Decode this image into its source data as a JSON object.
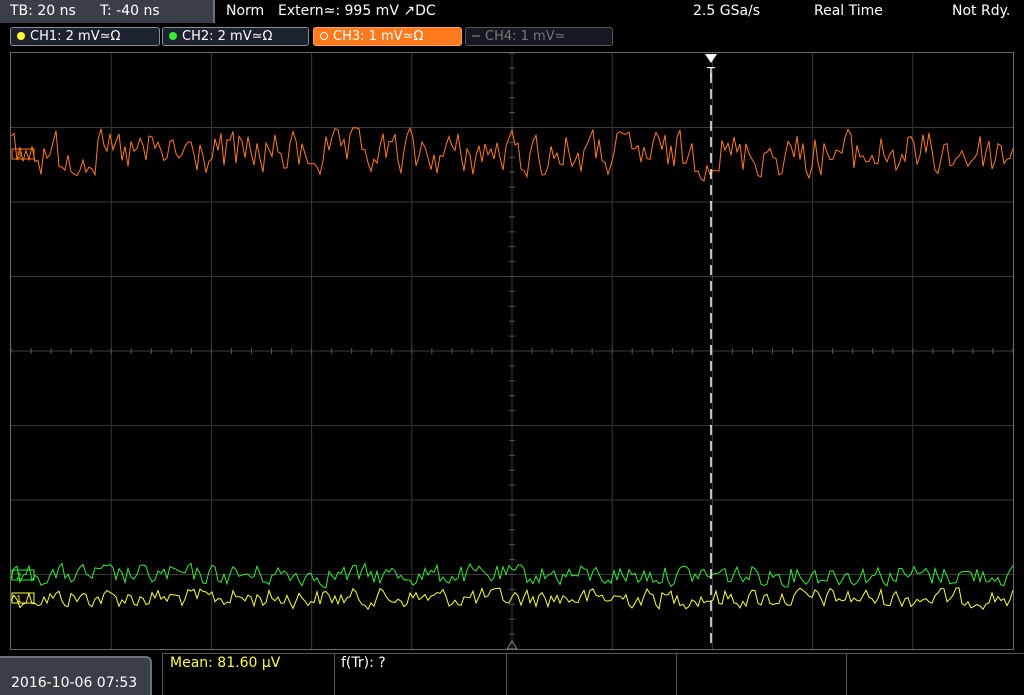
{
  "topbar": {
    "timebase": "TB: 20 ns",
    "trigger_pos": "T: -40 ns",
    "mode": "Norm",
    "trigger_source": "Extern≃: 995 mV ↗DC",
    "sample_rate": "2.5 GSa/s",
    "acq_mode": "Real Time",
    "status": "Not Rdy."
  },
  "channels": [
    {
      "label": "CH1: 2 mV≃Ω",
      "color": "#ffff33",
      "state": "on"
    },
    {
      "label": "CH2: 2 mV≃Ω",
      "color": "#33ee33",
      "state": "on"
    },
    {
      "label": "CH3: 1 mV≃Ω",
      "color": "#ff7a1c",
      "state": "active"
    },
    {
      "label": "CH4: 1 mV≃",
      "color": "#666666",
      "state": "off"
    }
  ],
  "markers": {
    "trigger": "T",
    "ch3": "3",
    "ch2": "2",
    "ch1": "1"
  },
  "traces": {
    "ch3_color": "#ff7a1c",
    "ch2_color": "#33ee33",
    "ch1_color": "#ffff33"
  },
  "bottom": {
    "datetime": "2016-10-06 07:53",
    "mean": "Mean: 81.60 µV",
    "frequency": "f(Tr): ?"
  }
}
